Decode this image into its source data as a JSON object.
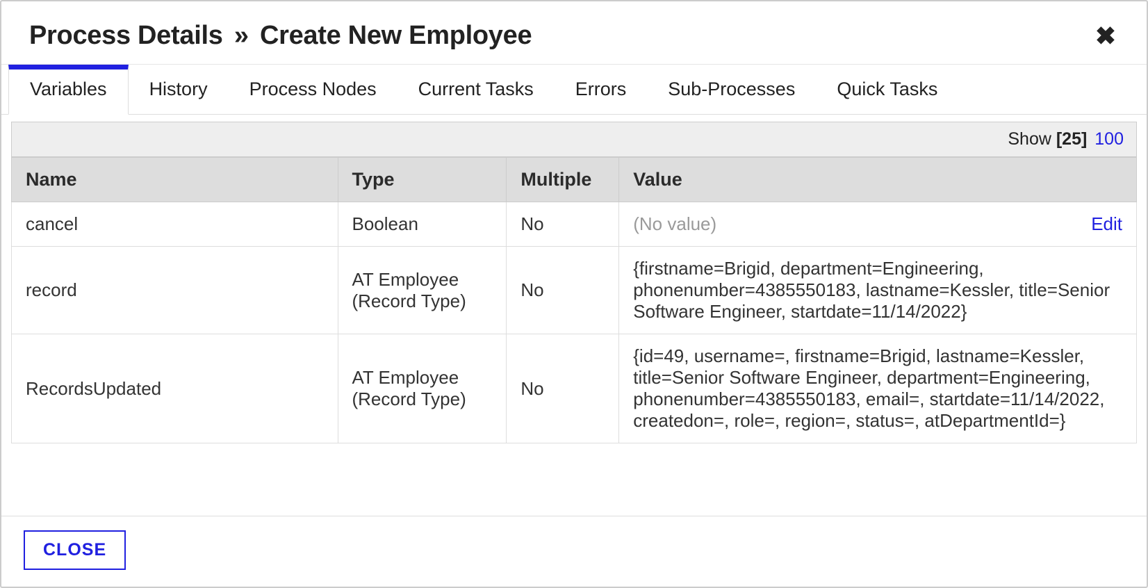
{
  "header": {
    "title_prefix": "Process Details",
    "title_sep": "»",
    "title_suffix": "Create New Employee"
  },
  "tabs": [
    {
      "label": "Variables",
      "active": true
    },
    {
      "label": "History",
      "active": false
    },
    {
      "label": "Process Nodes",
      "active": false
    },
    {
      "label": "Current Tasks",
      "active": false
    },
    {
      "label": "Errors",
      "active": false
    },
    {
      "label": "Sub-Processes",
      "active": false
    },
    {
      "label": "Quick Tasks",
      "active": false
    }
  ],
  "show_bar": {
    "label": "Show",
    "selected": "[25]",
    "other": "100"
  },
  "table": {
    "columns": {
      "name": "Name",
      "type": "Type",
      "multiple": "Multiple",
      "value": "Value"
    },
    "rows": [
      {
        "name": "cancel",
        "type": "Boolean",
        "multiple": "No",
        "value": "(No value)",
        "value_muted": true,
        "editable": true,
        "edit_label": "Edit"
      },
      {
        "name": "record",
        "type": "AT Employee (Record Type)",
        "multiple": "No",
        "value": "{firstname=Brigid, department=Engineering, phonenumber=4385550183, lastname=Kessler, title=Senior Software Engineer, startdate=11/14/2022}",
        "value_muted": false,
        "editable": false
      },
      {
        "name": "RecordsUpdated",
        "type": "AT Employee (Record Type)",
        "multiple": "No",
        "value": "{id=49, username=, firstname=Brigid, lastname=Kessler, title=Senior Software Engineer, department=Engineering, phonenumber=4385550183, email=, startdate=11/14/2022, createdon=, role=, region=, status=, atDepartmentId=}",
        "value_muted": false,
        "editable": false
      }
    ]
  },
  "footer": {
    "close_label": "CLOSE"
  }
}
